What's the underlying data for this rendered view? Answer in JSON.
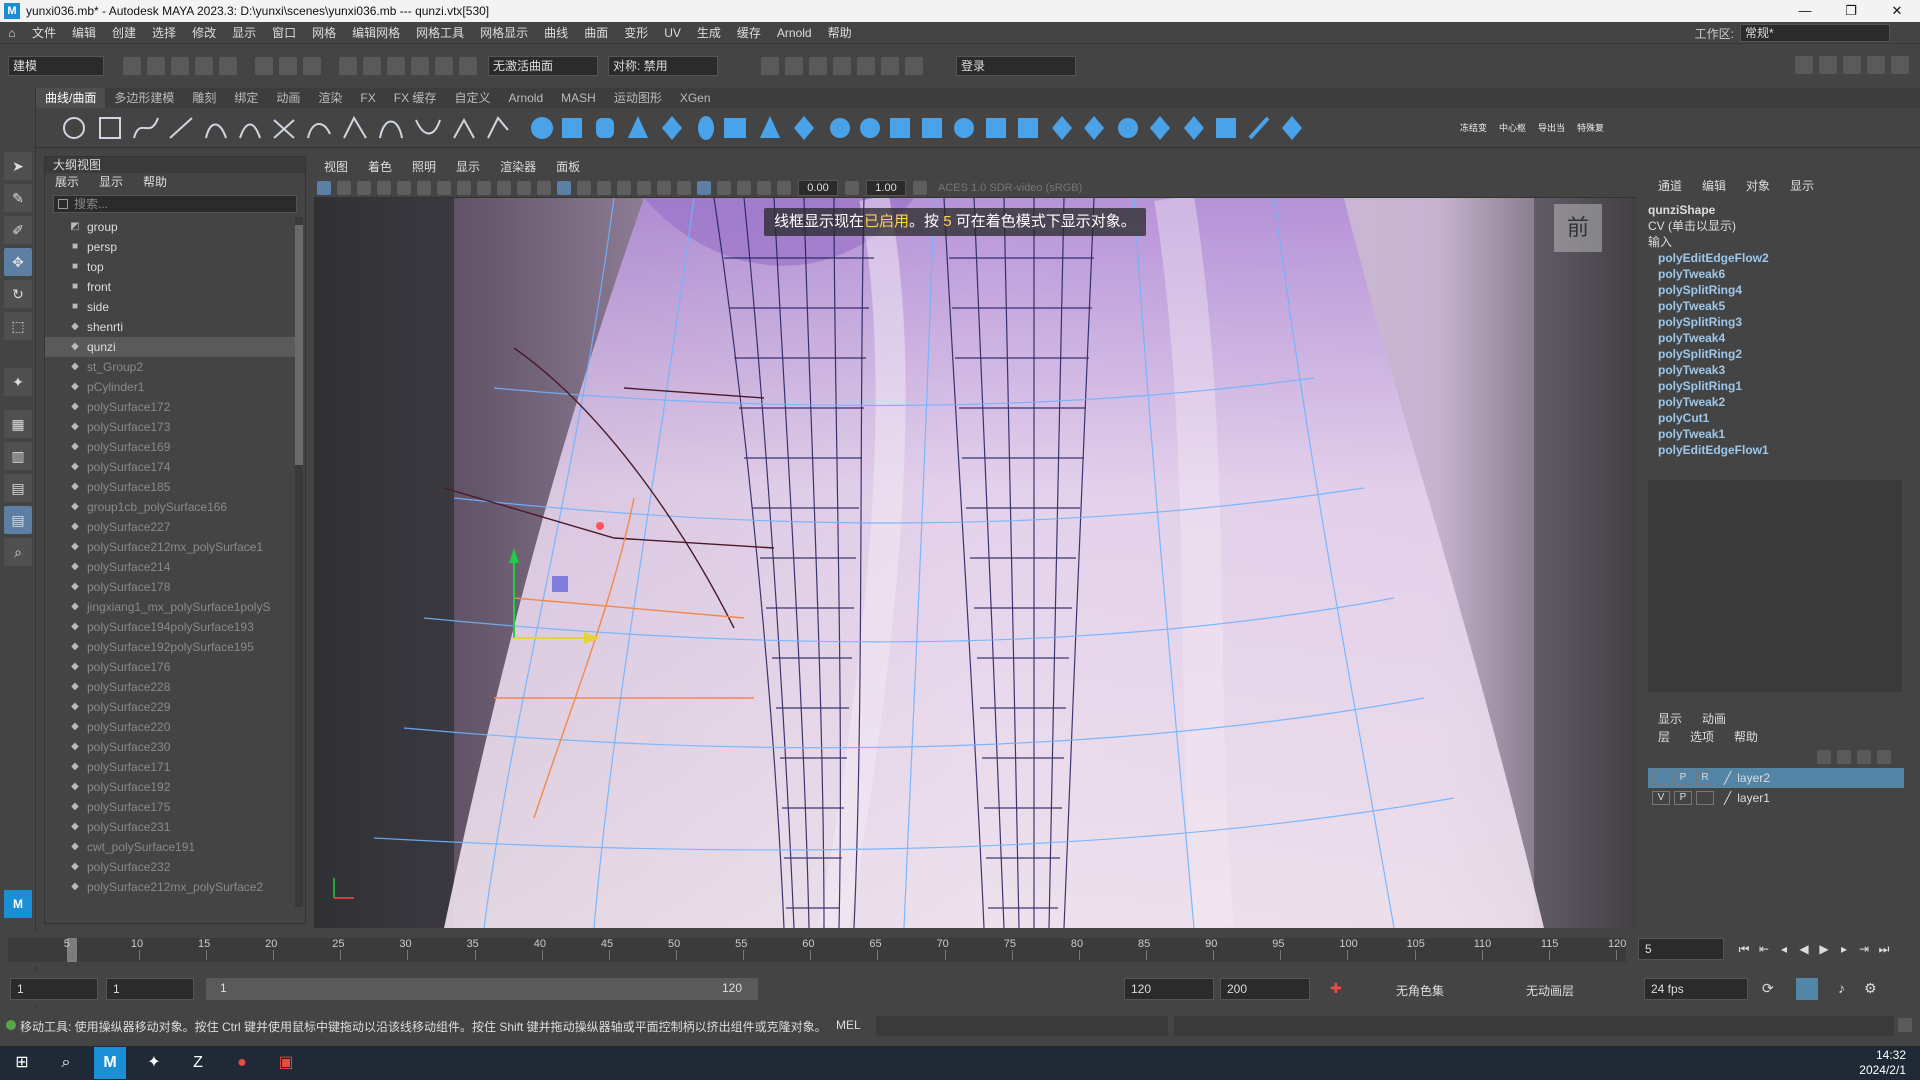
{
  "window": {
    "title": "yunxi036.mb* - Autodesk MAYA 2023.3: D:\\yunxi\\scenes\\yunxi036.mb   ---   qunzi.vtx[530]",
    "logo_text": "M"
  },
  "menubar": {
    "items": [
      "文件",
      "编辑",
      "创建",
      "选择",
      "修改",
      "显示",
      "窗口",
      "网格",
      "编辑网格",
      "网格工具",
      "网格显示",
      "曲线",
      "曲面",
      "变形",
      "UV",
      "生成",
      "缓存",
      "Arnold",
      "帮助"
    ],
    "workspace_label": "工作区:",
    "workspace_value": "常规*"
  },
  "statusline": {
    "mode": "建模",
    "live_surface": "无激活曲面",
    "symmetry": "对称: 禁用",
    "login": "登录"
  },
  "shelf": {
    "tabs": [
      "曲线/曲面",
      "多边形建模",
      "雕刻",
      "绑定",
      "动画",
      "渲染",
      "FX",
      "FX 缓存",
      "自定义",
      "Arnold",
      "MASH",
      "运动图形",
      "XGen"
    ],
    "active_tab": 0,
    "labels": [
      "冻结变",
      "中心枢",
      "导出当",
      "特殊复"
    ]
  },
  "outliner": {
    "title": "大纲视图",
    "menu": [
      "展示",
      "显示",
      "帮助"
    ],
    "search_placeholder": "搜索...",
    "items": [
      {
        "label": "group",
        "dim": false,
        "sel": false,
        "icon": "group-icon"
      },
      {
        "label": "persp",
        "dim": false,
        "sel": false,
        "icon": "camera-icon"
      },
      {
        "label": "top",
        "dim": false,
        "sel": false,
        "icon": "camera-icon"
      },
      {
        "label": "front",
        "dim": false,
        "sel": false,
        "icon": "camera-icon"
      },
      {
        "label": "side",
        "dim": false,
        "sel": false,
        "icon": "camera-icon"
      },
      {
        "label": "shenrti",
        "dim": false,
        "sel": false,
        "icon": "mesh-icon"
      },
      {
        "label": "qunzi",
        "dim": false,
        "sel": true,
        "icon": "mesh-icon"
      },
      {
        "label": "st_Group2",
        "dim": true,
        "sel": false,
        "icon": "mesh-icon"
      },
      {
        "label": "pCylinder1",
        "dim": true,
        "sel": false,
        "icon": "mesh-icon"
      },
      {
        "label": "polySurface172",
        "dim": true,
        "sel": false,
        "icon": "mesh-icon"
      },
      {
        "label": "polySurface173",
        "dim": true,
        "sel": false,
        "icon": "mesh-icon"
      },
      {
        "label": "polySurface169",
        "dim": true,
        "sel": false,
        "icon": "mesh-icon"
      },
      {
        "label": "polySurface174",
        "dim": true,
        "sel": false,
        "icon": "mesh-icon"
      },
      {
        "label": "polySurface185",
        "dim": true,
        "sel": false,
        "icon": "mesh-icon"
      },
      {
        "label": "group1cb_polySurface166",
        "dim": true,
        "sel": false,
        "icon": "mesh-icon"
      },
      {
        "label": "polySurface227",
        "dim": true,
        "sel": false,
        "icon": "mesh-icon"
      },
      {
        "label": "polySurface212mx_polySurface1",
        "dim": true,
        "sel": false,
        "icon": "mesh-icon"
      },
      {
        "label": "polySurface214",
        "dim": true,
        "sel": false,
        "icon": "mesh-icon"
      },
      {
        "label": "polySurface178",
        "dim": true,
        "sel": false,
        "icon": "mesh-icon"
      },
      {
        "label": "jingxiang1_mx_polySurface1polyS",
        "dim": true,
        "sel": false,
        "icon": "mesh-icon"
      },
      {
        "label": "polySurface194polySurface193",
        "dim": true,
        "sel": false,
        "icon": "mesh-icon"
      },
      {
        "label": "polySurface192polySurface195",
        "dim": true,
        "sel": false,
        "icon": "mesh-icon"
      },
      {
        "label": "polySurface176",
        "dim": true,
        "sel": false,
        "icon": "mesh-icon"
      },
      {
        "label": "polySurface228",
        "dim": true,
        "sel": false,
        "icon": "mesh-icon"
      },
      {
        "label": "polySurface229",
        "dim": true,
        "sel": false,
        "icon": "mesh-icon"
      },
      {
        "label": "polySurface220",
        "dim": true,
        "sel": false,
        "icon": "mesh-icon"
      },
      {
        "label": "polySurface230",
        "dim": true,
        "sel": false,
        "icon": "mesh-icon"
      },
      {
        "label": "polySurface171",
        "dim": true,
        "sel": false,
        "icon": "mesh-icon"
      },
      {
        "label": "polySurface192",
        "dim": true,
        "sel": false,
        "icon": "mesh-icon"
      },
      {
        "label": "polySurface175",
        "dim": true,
        "sel": false,
        "icon": "mesh-icon"
      },
      {
        "label": "polySurface231",
        "dim": true,
        "sel": false,
        "icon": "mesh-icon"
      },
      {
        "label": "cwt_polySurface191",
        "dim": true,
        "sel": false,
        "icon": "mesh-icon"
      },
      {
        "label": "polySurface232",
        "dim": true,
        "sel": false,
        "icon": "mesh-icon"
      },
      {
        "label": "polySurface212mx_polySurface2",
        "dim": true,
        "sel": false,
        "icon": "mesh-icon"
      }
    ]
  },
  "viewport": {
    "menu": [
      "视图",
      "着色",
      "照明",
      "显示",
      "渲染器",
      "面板"
    ],
    "exposure": "0.00",
    "gamma": "1.00",
    "colorspace": "ACES 1.0 SDR-video (sRGB)",
    "hud_prefix": "线框显示现在",
    "hud_enabled": "已启用",
    "hud_mid": "。按 ",
    "hud_key": "5",
    "hud_suffix": " 可在着色模式下显示对象。",
    "camera_label": "前"
  },
  "channelbox": {
    "menu": [
      "通道",
      "编辑",
      "对象",
      "显示"
    ],
    "shape": "qunziShape",
    "cv_note": "CV (单击以显示)",
    "inputs_label": "输入",
    "inputs": [
      "polyEditEdgeFlow2",
      "polyTweak6",
      "polySplitRing4",
      "polyTweak5",
      "polySplitRing3",
      "polyTweak4",
      "polySplitRing2",
      "polyTweak3",
      "polySplitRing1",
      "polyTweak2",
      "polyCut1",
      "polyTweak1",
      "polyEditEdgeFlow1"
    ]
  },
  "layers": {
    "tabs": [
      "显示",
      "动画"
    ],
    "menu": [
      "层",
      "选项",
      "帮助"
    ],
    "rows": [
      {
        "v": "",
        "p": "P",
        "r": "R",
        "name": "layer2",
        "sel": true
      },
      {
        "v": "V",
        "p": "P",
        "r": "",
        "name": "layer1",
        "sel": false
      }
    ]
  },
  "timeline": {
    "ticks": [
      5,
      10,
      15,
      20,
      25,
      30,
      35,
      40,
      45,
      50,
      55,
      60,
      65,
      70,
      75,
      80,
      85,
      90,
      95,
      100,
      105,
      110,
      115,
      120
    ],
    "range_start": 1,
    "range_end": 120,
    "current_frame": "5"
  },
  "range": {
    "start": "1",
    "inner_start": "1",
    "slider_start": "1",
    "slider_end": "120",
    "end": "120",
    "max": "200",
    "charset": "无角色集",
    "anim_layer": "无动画层",
    "fps": "24 fps"
  },
  "cmdline": {
    "help": "移动工具: 使用操纵器移动对象。按住 Ctrl 键并使用鼠标中键拖动以沿该线移动组件。按住 Shift 键并拖动操纵器轴或平面控制柄以挤出组件或克隆对象。按住 C",
    "mel": "MEL"
  },
  "taskbar": {
    "time": "14:32",
    "date": "2024/2/1"
  },
  "colors": {
    "accent": "#5285a6",
    "hud_highlight": "#ffd34a",
    "wire": "#1e1a5a",
    "edge": "#6fb4ff"
  }
}
